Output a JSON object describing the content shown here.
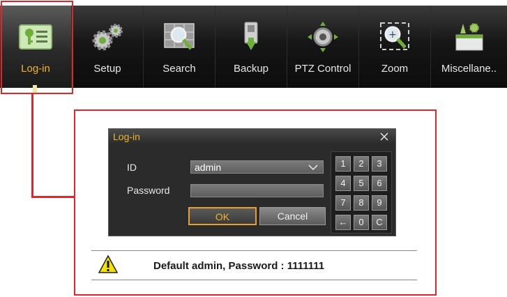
{
  "menu": {
    "items": [
      {
        "label": "Log-in",
        "icon": "login-icon",
        "active": true
      },
      {
        "label": "Setup",
        "icon": "gears-icon"
      },
      {
        "label": "Search",
        "icon": "search-icon"
      },
      {
        "label": "Backup",
        "icon": "backup-icon"
      },
      {
        "label": "PTZ Control",
        "icon": "ptz-icon"
      },
      {
        "label": "Zoom",
        "icon": "zoom-icon"
      },
      {
        "label": "Miscellane..",
        "icon": "misc-icon"
      }
    ]
  },
  "dialog": {
    "title": "Log-in",
    "close": "X",
    "id_label": "ID",
    "id_value": "admin",
    "password_label": "Password",
    "password_value": "",
    "ok_label": "OK",
    "cancel_label": "Cancel",
    "keypad": [
      "1",
      "2",
      "3",
      "4",
      "5",
      "6",
      "7",
      "8",
      "9",
      "←",
      "0",
      "C"
    ]
  },
  "note": {
    "text": "Default admin, Password : 1111111"
  },
  "colors": {
    "accent": "#f0b428",
    "frame": "#e0262b"
  }
}
